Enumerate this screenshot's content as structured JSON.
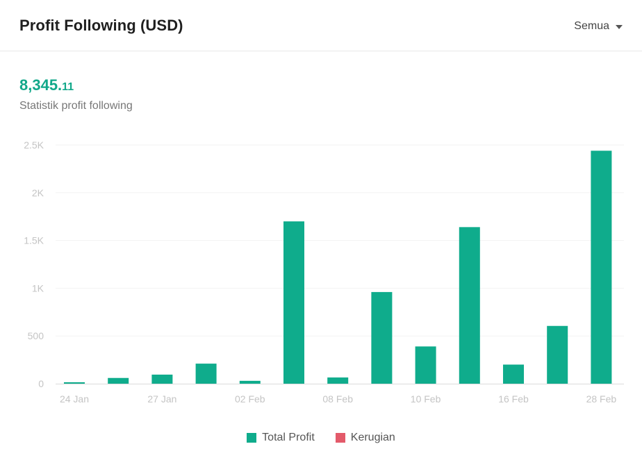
{
  "header": {
    "title": "Profit Following (USD)",
    "filter_label": "Semua",
    "filter_icon": "caret-down-icon"
  },
  "summary": {
    "total_int": "8,345.",
    "total_dec": "11",
    "subtitle": "Statistik profit following"
  },
  "colors": {
    "profit": "#0fac8c",
    "loss": "#e35a6a",
    "accent_text": "#12a88a"
  },
  "legend": [
    {
      "label": "Total Profit",
      "color": "#0fac8c"
    },
    {
      "label": "Kerugian",
      "color": "#e35a6a"
    }
  ],
  "chart_data": {
    "type": "bar",
    "categories": [
      "24 Jan",
      "",
      "27 Jan",
      "",
      "02 Feb",
      "",
      "08 Feb",
      "",
      "10 Feb",
      "",
      "16 Feb",
      "",
      "28 Feb"
    ],
    "x_tick_labels": [
      "24 Jan",
      "27 Jan",
      "02 Feb",
      "08 Feb",
      "10 Feb",
      "16 Feb",
      "28 Feb"
    ],
    "series": [
      {
        "name": "Total Profit",
        "values": [
          15,
          60,
          95,
          210,
          30,
          1700,
          65,
          960,
          390,
          1640,
          200,
          605,
          2440
        ]
      },
      {
        "name": "Kerugian",
        "values": [
          0,
          0,
          0,
          0,
          0,
          0,
          0,
          0,
          0,
          0,
          0,
          0,
          0
        ]
      }
    ],
    "y_ticks": [
      0,
      500,
      1000,
      1500,
      2000,
      2500
    ],
    "y_tick_labels": [
      "0",
      "500",
      "1K",
      "1.5K",
      "2K",
      "2.5K"
    ],
    "ylim": [
      0,
      2500
    ],
    "grid": true,
    "legend_position": "bottom-center"
  }
}
